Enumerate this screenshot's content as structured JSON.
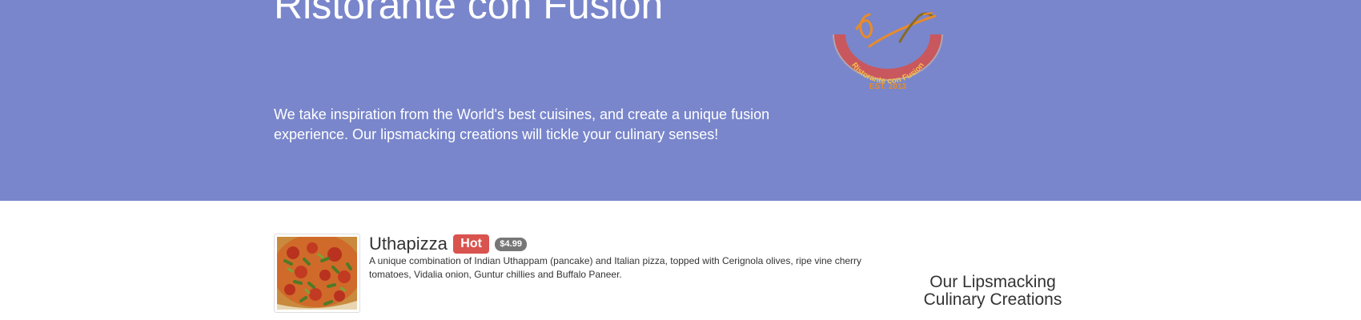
{
  "hero": {
    "title": "Ristorante con Fusion",
    "tagline": "We take inspiration from the World's best cuisines, and create a unique fusion experience. Our lipsmacking creations will tickle your culinary senses!",
    "bg_color": "#7986cb",
    "logo": {
      "ring_text": "Ristorante con Fusion",
      "est_text": "EST. 2013",
      "icon": "restaurant-logo"
    }
  },
  "featured_dish": {
    "name": "Uthapizza",
    "badge": "Hot",
    "price": "$4.99",
    "description": "A unique combination of Indian Uthappam (pancake) and Italian pizza, topped with Cerignola olives, ripe vine cherry tomatoes, Vidalia onion, Guntur chillies and Buffalo Paneer.",
    "image_icon": "pizza-image",
    "badge_color": "#d9534f",
    "price_badge_color": "#777777"
  },
  "sidebar": {
    "heading": "Our Lipsmacking Culinary Creations"
  }
}
